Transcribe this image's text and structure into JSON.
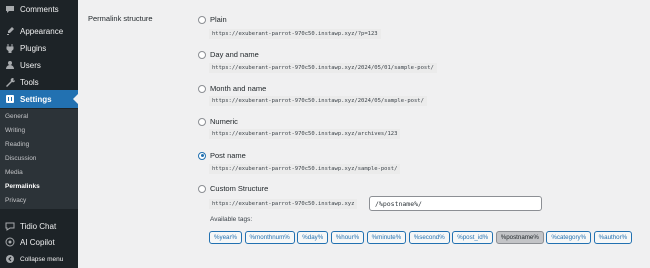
{
  "sidebar": {
    "items": [
      {
        "label": "Comments",
        "icon": "comments-icon"
      },
      {
        "label": "Appearance",
        "icon": "appearance-icon"
      },
      {
        "label": "Plugins",
        "icon": "plugins-icon"
      },
      {
        "label": "Users",
        "icon": "users-icon"
      },
      {
        "label": "Tools",
        "icon": "tools-icon"
      },
      {
        "label": "Settings",
        "icon": "settings-icon"
      }
    ],
    "submenu": [
      "General",
      "Writing",
      "Reading",
      "Discussion",
      "Media",
      "Permalinks",
      "Privacy"
    ],
    "bottom": [
      {
        "label": "Tidio Chat",
        "icon": "chat-icon"
      },
      {
        "label": "AI Copilot",
        "icon": "copilot-icon"
      },
      {
        "label": "Collapse menu",
        "icon": "collapse-icon"
      }
    ]
  },
  "main": {
    "field_label": "Permalink structure",
    "options": [
      {
        "label": "Plain",
        "example": "https://exuberant-parrot-970c50.instawp.xyz/?p=123",
        "checked": false
      },
      {
        "label": "Day and name",
        "example": "https://exuberant-parrot-970c50.instawp.xyz/2024/05/01/sample-post/",
        "checked": false
      },
      {
        "label": "Month and name",
        "example": "https://exuberant-parrot-970c50.instawp.xyz/2024/05/sample-post/",
        "checked": false
      },
      {
        "label": "Numeric",
        "example": "https://exuberant-parrot-970c50.instawp.xyz/archives/123",
        "checked": false
      },
      {
        "label": "Post name",
        "example": "https://exuberant-parrot-970c50.instawp.xyz/sample-post/",
        "checked": true
      },
      {
        "label": "Custom Structure",
        "example": "https://exuberant-parrot-970c50.instawp.xyz",
        "checked": false
      }
    ],
    "custom_value": "/%postname%/",
    "available_tags_label": "Available tags:",
    "tags": [
      "%year%",
      "%monthnum%",
      "%day%",
      "%hour%",
      "%minute%",
      "%second%",
      "%post_id%",
      "%postname%",
      "%category%",
      "%author%"
    ],
    "pressed_tag": "%postname%"
  },
  "colors": {
    "accent": "#2271b1",
    "sidebar_bg": "#1d2327",
    "page_bg": "#f0f0f1"
  }
}
